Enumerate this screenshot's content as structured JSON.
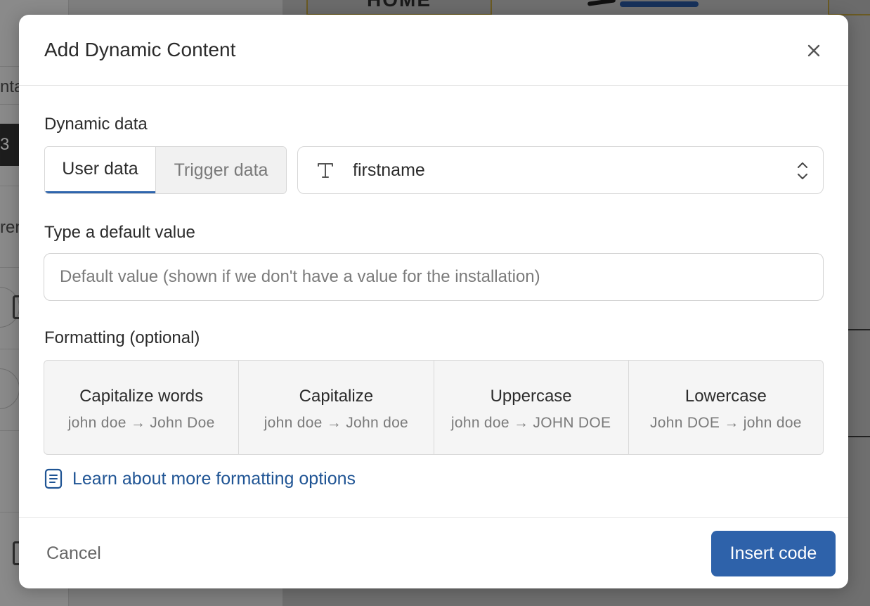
{
  "background": {
    "left_fragments": [
      "nta",
      "3",
      "ren"
    ],
    "home_label": "HOME"
  },
  "dialog": {
    "title": "Add Dynamic Content",
    "close_icon": "close-icon",
    "dynamic_data": {
      "label": "Dynamic data",
      "tabs": [
        {
          "label": "User data",
          "active": true
        },
        {
          "label": "Trigger data",
          "active": false
        }
      ],
      "field": {
        "icon": "text-type-icon",
        "value": "firstname"
      }
    },
    "default_value": {
      "label": "Type a default value",
      "value": "",
      "placeholder": "Default value (shown if we don't have a value for the installation)"
    },
    "formatting": {
      "label": "Formatting (optional)",
      "options": [
        {
          "title": "Capitalize words",
          "example": "john doe → John Doe"
        },
        {
          "title": "Capitalize",
          "example": "john doe → John doe"
        },
        {
          "title": "Uppercase",
          "example": "john doe → JOHN DOE"
        },
        {
          "title": "Lowercase",
          "example": "John DOE → john doe"
        }
      ]
    },
    "learn_link": {
      "icon": "document-icon",
      "label": "Learn about more formatting options"
    },
    "footer": {
      "cancel_label": "Cancel",
      "insert_label": "Insert code"
    }
  },
  "colors": {
    "primary": "#2e62aa",
    "link": "#1f5494",
    "active_tab_underline": "#2f65ad"
  }
}
